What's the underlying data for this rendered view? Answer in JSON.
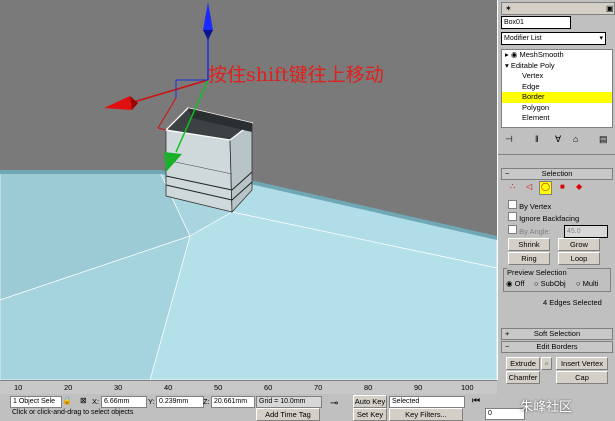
{
  "caption": "按住shift键往上移动",
  "panel": {
    "object_name": "Box01",
    "modifier_list": "Modifier List",
    "stack": [
      "MeshSmooth",
      "Editable Poly",
      "Vertex",
      "Edge",
      "Border",
      "Polygon",
      "Element"
    ],
    "selection_title": "Selection",
    "by_vertex": "By Vertex",
    "ignore_backfacing": "Ignore Backfacing",
    "by_angle": "By Angle:",
    "by_angle_value": "45.0",
    "shrink": "Shrink",
    "grow": "Grow",
    "ring": "Ring",
    "loop": "Loop",
    "preview_selection": "Preview Selection",
    "preview_off": "Off",
    "preview_subobj": "SubObj",
    "preview_multi": "Multi",
    "selected_info": "4 Edges Selected",
    "soft_selection": "Soft Selection",
    "edit_borders": "Edit Borders",
    "extrude": "Extrude",
    "insert_vertex": "Insert Vertex",
    "chamfer": "Chamfer",
    "cap": "Cap"
  },
  "timeline": {
    "ticks": [
      "10",
      "20",
      "30",
      "40",
      "50",
      "60",
      "70",
      "80",
      "90",
      "100"
    ]
  },
  "status": {
    "selection_count": "1 Object Sele",
    "x_label": "X:",
    "x_value": "6.66mm",
    "y_label": "Y:",
    "y_value": "0.239mm",
    "z_label": "Z:",
    "z_value": "20.661mm",
    "grid": "Grid = 10.0mm",
    "auto_key": "Auto Key",
    "key_mode": "Selected",
    "prompt": "Click or click-and-drag to select objects",
    "add_time_tag": "Add Time Tag",
    "set_key": "Set Key",
    "key_filters": "Key Filters...",
    "frame": "0"
  },
  "watermark": "朱峰社区"
}
